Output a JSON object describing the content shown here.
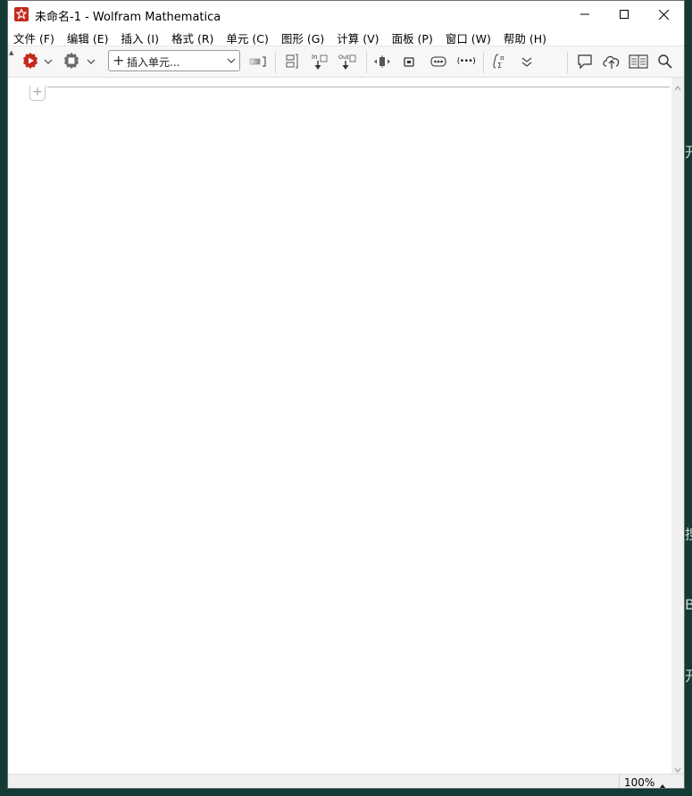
{
  "window": {
    "title": "未命名-1 - Wolfram Mathematica"
  },
  "menu": {
    "items": [
      {
        "label": "文件 (F)"
      },
      {
        "label": "编辑 (E)"
      },
      {
        "label": "插入 (I)"
      },
      {
        "label": "格式 (R)"
      },
      {
        "label": "单元 (C)"
      },
      {
        "label": "图形 (G)"
      },
      {
        "label": "计算 (V)"
      },
      {
        "label": "面板 (P)"
      },
      {
        "label": "窗口 (W)"
      },
      {
        "label": "帮助 (H)"
      }
    ]
  },
  "toolbar": {
    "insert_cell_label": "插入单元...",
    "input_icon_text": "In",
    "output_icon_text": "Out",
    "brackets_text": "(•••)"
  },
  "statusbar": {
    "zoom": "100%"
  },
  "background": {
    "edge_chars": [
      "开",
      "搜",
      "B",
      "开"
    ]
  },
  "colors": {
    "desktop": "#113b33",
    "app_icon": "#c42a1c",
    "window_bg": "#ffffff",
    "toolbar_bg": "#f7f7f7"
  }
}
